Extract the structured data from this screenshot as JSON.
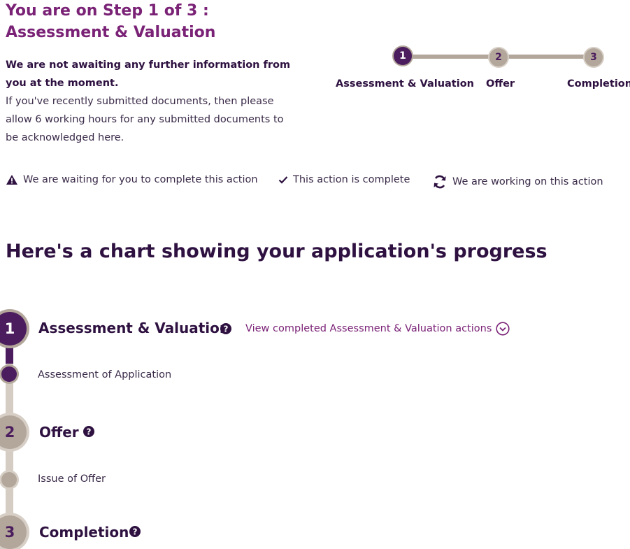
{
  "header": {
    "title": "You are on Step 1 of 3 : Assessment & Valuation",
    "notice_strong": "We are not awaiting any further information from you at the moment.",
    "notice_text": "If you've recently submitted documents, then please allow 6 working hours for any submitted documents to be acknowledged here."
  },
  "stepper": {
    "steps": [
      {
        "number": "1",
        "label": "Assessment & Valuation",
        "state": "active"
      },
      {
        "number": "2",
        "label": "Offer",
        "state": "inactive"
      },
      {
        "number": "3",
        "label": "Completion",
        "state": "inactive"
      }
    ]
  },
  "legend": {
    "waiting": {
      "icon": "warning-icon",
      "label": "We are waiting for you to complete this action"
    },
    "complete": {
      "icon": "checkmark-icon",
      "label": "This action is complete"
    },
    "working": {
      "icon": "refresh-icon",
      "label": "We are working on this action"
    }
  },
  "progress": {
    "heading": "Here's a chart showing your application's progress",
    "stages": [
      {
        "number": "1",
        "title": "Assessment & Valuation",
        "state": "active",
        "link": "View completed Assessment & Valuation actions",
        "sub": "Assessment of Application"
      },
      {
        "number": "2",
        "title": "Offer",
        "state": "inactive",
        "sub": "Issue of Offer"
      },
      {
        "number": "3",
        "title": "Completion",
        "state": "inactive"
      }
    ]
  },
  "colors": {
    "brand_purple": "#4b1d5e",
    "title_magenta": "#7a2276",
    "inactive_taupe": "#b3a79b"
  }
}
